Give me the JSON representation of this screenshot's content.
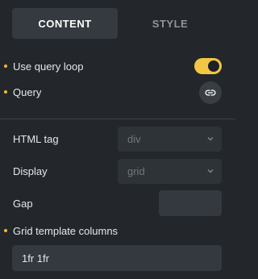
{
  "tabs": [
    {
      "label": "CONTENT",
      "active": true
    },
    {
      "label": "STYLE",
      "active": false
    }
  ],
  "controls": {
    "use_query_loop": {
      "label": "Use query loop",
      "value": true
    },
    "query": {
      "label": "Query",
      "icon": "link-icon"
    },
    "html_tag": {
      "label": "HTML tag",
      "value": "div"
    },
    "display": {
      "label": "Display",
      "value": "grid"
    },
    "gap": {
      "label": "Gap",
      "value": ""
    },
    "grid_template_columns": {
      "label": "Grid template columns",
      "value": "1fr 1fr"
    }
  },
  "colors": {
    "accent": "#f2c744",
    "background": "#23272b",
    "indicator_dot": "#f2b92e"
  }
}
